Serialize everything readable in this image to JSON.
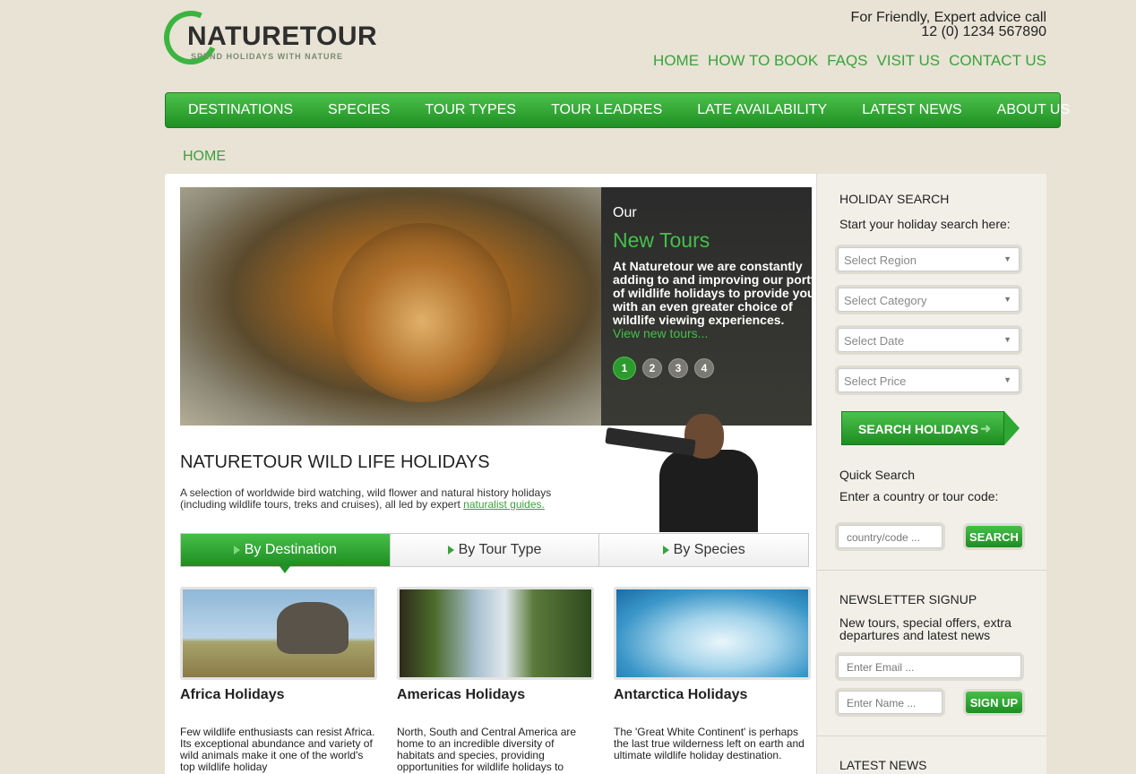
{
  "brand": {
    "name": "NATURETOUR",
    "tagline": "SPEND HOLIDAYS WITH NATURE"
  },
  "contact": {
    "line1": "For Friendly, Expert advice call",
    "phone": "12 (0) 1234 567890"
  },
  "topnav": [
    "HOME",
    "HOW TO BOOK",
    "FAQS",
    "VISIT US",
    "CONTACT US"
  ],
  "mainnav": [
    "DESTINATIONS",
    "SPECIES",
    "TOUR TYPES",
    "TOUR LEADRES",
    "LATE AVAILABILITY",
    "LATEST NEWS",
    "ABOUT US"
  ],
  "breadcrumb": "HOME",
  "hero": {
    "over": "Our",
    "title": "New Tours",
    "text_lines": [
      "At Naturetour we are constantly",
      "adding to and improving our portfol",
      "of wildlife holidays to provide you",
      "with an even greater choice of",
      "wildlife viewing experiences."
    ],
    "link": "View new tours...",
    "pages": [
      "1",
      "2",
      "3",
      "4"
    ],
    "active_page": "1"
  },
  "intro": {
    "heading": "NATURETOUR WILD LIFE HOLIDAYS",
    "text": "A selection of worldwide bird watching, wild flower and natural history holidays (including wildlife tours, treks and cruises), all led by expert ",
    "link": "naturalist guides."
  },
  "tabs": [
    "By Destination",
    "By Tour Type",
    "By Species"
  ],
  "cards": [
    {
      "title": "Africa Holidays",
      "desc": "Few wildlife enthusiasts can resist Africa. Its exceptional abundance and variety of wild animals make it one of the world's top wildlife holiday"
    },
    {
      "title": "Americas Holidays",
      "desc": "North, South and Central America are home to an incredible diversity of habitats and species, providing opportunities for wildlife holidays to"
    },
    {
      "title": "Antarctica Holidays",
      "desc": "The 'Great White Continent' is perhaps the last true wilderness left on earth and ultimate wildlife holiday destination."
    }
  ],
  "sidebar": {
    "search_title": "HOLIDAY SEARCH",
    "search_sub": "Start your holiday search here:",
    "selects": [
      "Select Region",
      "Select Category",
      "Select Date",
      "Select Price"
    ],
    "search_button": "SEARCH HOLIDAYS",
    "quick_title": "Quick Search",
    "quick_sub": "Enter a country or tour code:",
    "quick_placeholder": "country/code ...",
    "quick_button": "SEARCH",
    "news_title": "NEWSLETTER SIGNUP",
    "news_sub": "New tours, special offers, extra departures and latest news",
    "email_placeholder": "Enter Email ...",
    "name_placeholder": "Enter Name ...",
    "signup_button": "SIGN UP",
    "latest_title": "LATEST NEWS"
  },
  "colors": {
    "accent": "#3aa23a",
    "nav_green": "#2da831",
    "bg": "#e8e3d5"
  }
}
